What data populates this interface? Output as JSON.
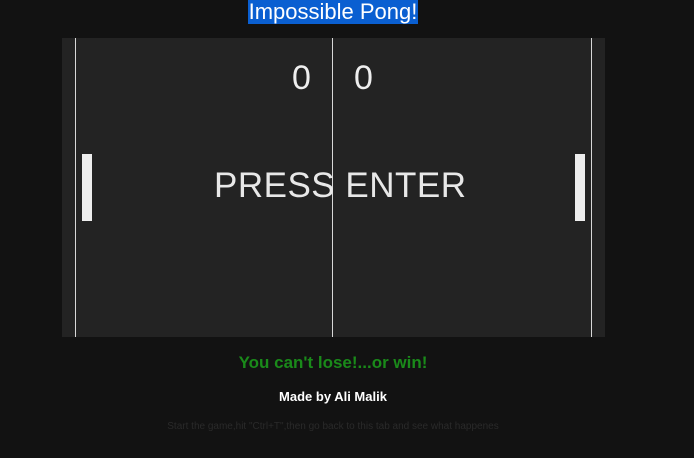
{
  "page": {
    "title": "Impossible Pong!",
    "title_highlight_color": "#0a5fd1"
  },
  "game": {
    "score_left": "0",
    "score_right": "0",
    "prompt": "PRESS ENTER",
    "board_color": "#232323",
    "paddle_color": "#eeeeee"
  },
  "footer": {
    "tagline": "You can't lose!...or win!",
    "credit": "Made by Ali Malik",
    "hint": "Start the game,hit \"Ctrl+T\",then go back to this tab and see what happenes"
  }
}
